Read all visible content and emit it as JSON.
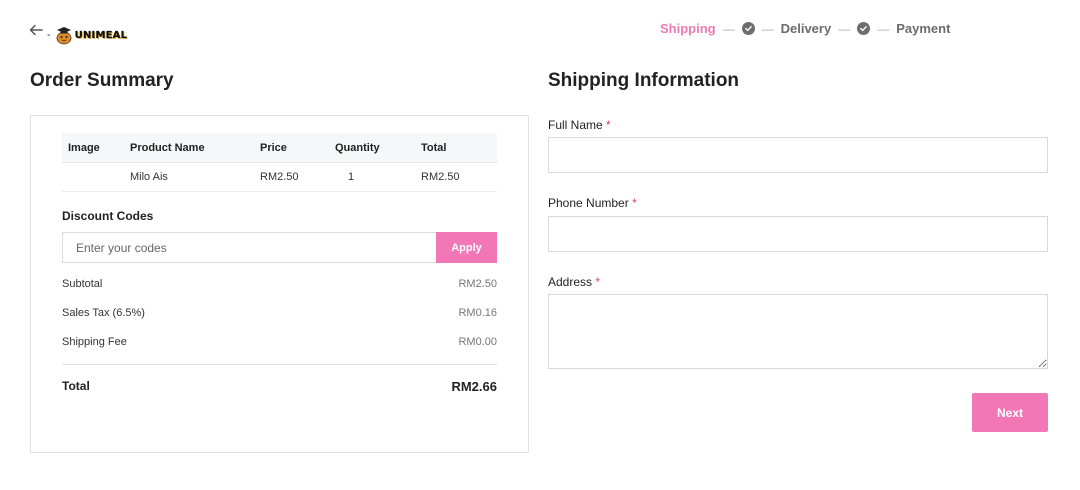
{
  "header": {
    "back_icon": "arrow-left-icon",
    "logo_text": "UNIMEAL",
    "steps": [
      {
        "label": "Shipping",
        "active": true
      },
      {
        "label": "Delivery",
        "active": false
      },
      {
        "label": "Payment",
        "active": false
      }
    ],
    "step_check_icon": "check-circle-icon"
  },
  "order_summary": {
    "title": "Order Summary",
    "table": {
      "columns": [
        "Image",
        "Product Name",
        "Price",
        "Quantity",
        "Total"
      ],
      "rows": [
        {
          "image": "",
          "name": "Milo Ais",
          "price": "RM2.50",
          "quantity": "1",
          "total": "RM2.50"
        }
      ]
    },
    "discount": {
      "label": "Discount Codes",
      "placeholder": "Enter your codes",
      "value": "",
      "apply_label": "Apply"
    },
    "summary": [
      {
        "label": "Subtotal",
        "value": "RM2.50"
      },
      {
        "label": "Sales Tax (6.5%)",
        "value": "RM0.16"
      },
      {
        "label": "Shipping Fee",
        "value": "RM0.00"
      }
    ],
    "total": {
      "label": "Total",
      "value": "RM2.66"
    }
  },
  "shipping": {
    "title": "Shipping Information",
    "fields": [
      {
        "label": "Full Name",
        "required_mark": "*",
        "value": ""
      },
      {
        "label": "Phone Number",
        "required_mark": "*",
        "value": ""
      },
      {
        "label": "Address",
        "required_mark": "*",
        "value": ""
      }
    ],
    "next_label": "Next"
  },
  "colors": {
    "accent": "#f277b6",
    "active_step": "#ec7bb4",
    "required": "#e0435a"
  }
}
